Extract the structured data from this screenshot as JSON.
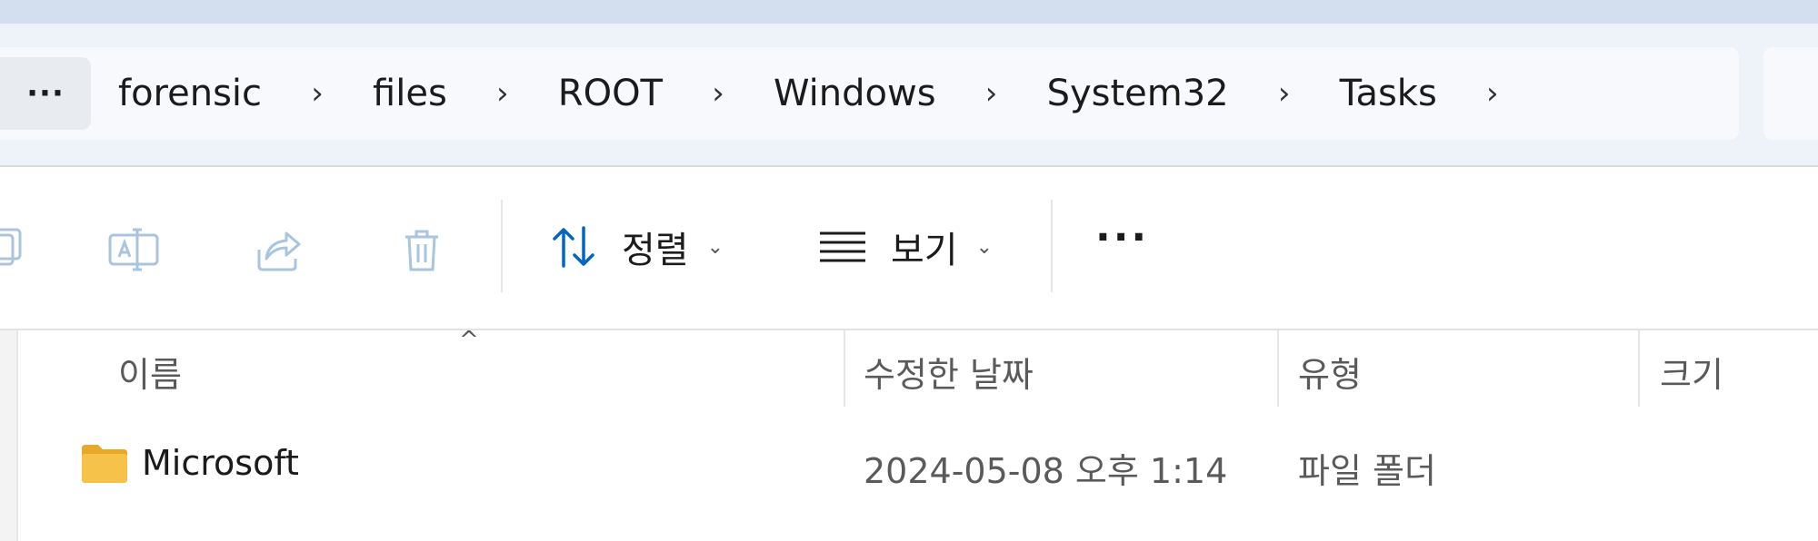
{
  "address_bar": {
    "more_label": "···",
    "crumbs": [
      "forensic",
      "files",
      "ROOT",
      "Windows",
      "System32",
      "Tasks"
    ],
    "separator": "›"
  },
  "toolbar": {
    "sort_label": "정렬",
    "view_label": "보기",
    "more_label": "···",
    "dropdown_chevron": "⌄",
    "icons": [
      "copy-icon",
      "rename-icon",
      "share-icon",
      "delete-icon",
      "sort-icon",
      "view-list-icon"
    ]
  },
  "file_list": {
    "sort_indicator": "^",
    "columns": [
      "이름",
      "수정한 날짜",
      "유형",
      "크기"
    ],
    "rows": [
      {
        "name": "Microsoft",
        "modified": "2024-05-08 오후 1:14",
        "type": "파일 폴더",
        "size": ""
      }
    ]
  },
  "colors": {
    "accent": "#0067c0",
    "disabled_icon": "#a9c4e0",
    "folder": "#f6c24a",
    "header_text": "#5a5a5a"
  }
}
